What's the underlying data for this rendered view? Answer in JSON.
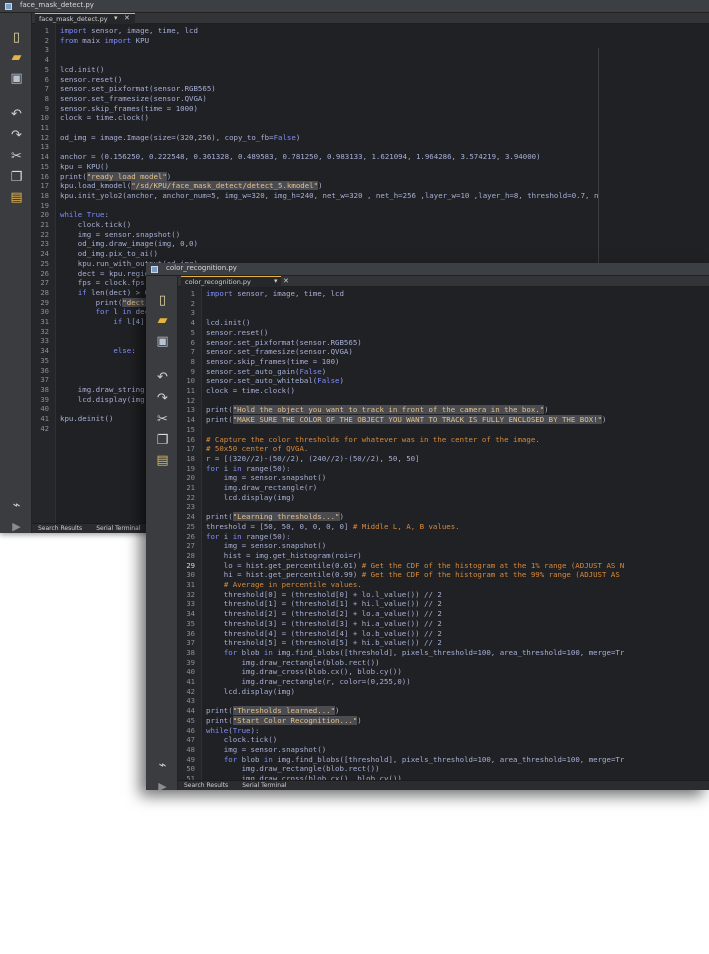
{
  "win1": {
    "title": "face_mask_detect.py",
    "tab": "face_mask_detect.py",
    "tab_menu": "▾",
    "tab_close": "✕",
    "status": [
      "Search Results",
      "Serial Terminal"
    ],
    "lines": [
      {
        "n": "1",
        "t": "import sensor, image, time, lcd"
      },
      {
        "n": "2",
        "t": "from maix import KPU"
      },
      {
        "n": "3",
        "t": ""
      },
      {
        "n": "4",
        "t": ""
      },
      {
        "n": "5",
        "t": "lcd.init()"
      },
      {
        "n": "6",
        "t": "sensor.reset()"
      },
      {
        "n": "7",
        "t": "sensor.set_pixformat(sensor.RGB565)"
      },
      {
        "n": "8",
        "t": "sensor.set_framesize(sensor.QVGA)"
      },
      {
        "n": "9",
        "t": "sensor.skip_frames(time = 1000)"
      },
      {
        "n": "10",
        "t": "clock = time.clock()"
      },
      {
        "n": "11",
        "t": ""
      },
      {
        "n": "12",
        "t": "od_img = image.Image(size=(320,256), copy_to_fb=False)"
      },
      {
        "n": "13",
        "t": ""
      },
      {
        "n": "14",
        "t": "anchor = (0.156250, 0.222548, 0.361328, 0.489583, 0.781250, 0.983133, 1.621094, 1.964286, 3.574219, 3.94000)"
      },
      {
        "n": "15",
        "t": "kpu = KPU()"
      },
      {
        "n": "16",
        "t": "print(\"ready load model\")"
      },
      {
        "n": "17",
        "t": "kpu.load_kmodel(\"/sd/KPU/face_mask_detect/detect_5.kmodel\")"
      },
      {
        "n": "18",
        "t": "kpu.init_yolo2(anchor, anchor_num=5, img_w=320, img_h=240, net_w=320 , net_h=256 ,layer_w=10 ,layer_h=8, threshold=0.7, n"
      },
      {
        "n": "19",
        "t": ""
      },
      {
        "n": "20",
        "t": "while True:"
      },
      {
        "n": "21",
        "t": "    clock.tick()"
      },
      {
        "n": "22",
        "t": "    img = sensor.snapshot()"
      },
      {
        "n": "23",
        "t": "    od_img.draw_image(img, 0,0)"
      },
      {
        "n": "24",
        "t": "    od_img.pix_to_ai()"
      },
      {
        "n": "25",
        "t": "    kpu.run_with_output(od_img)"
      },
      {
        "n": "26",
        "t": "    dect = kpu.regionlayer_yolo2()"
      },
      {
        "n": "27",
        "t": "    fps = clock.fps()"
      },
      {
        "n": "28",
        "t": "    if len(dect) > 0:"
      },
      {
        "n": "29",
        "t": "        print(\"dect:\",dect)"
      },
      {
        "n": "30",
        "t": "        for l in dect :"
      },
      {
        "n": "31",
        "t": "            if l[4] :"
      },
      {
        "n": "32",
        "t": ""
      },
      {
        "n": "33",
        "t": ""
      },
      {
        "n": "34",
        "t": "            else:"
      },
      {
        "n": "35",
        "t": ""
      },
      {
        "n": "36",
        "t": ""
      },
      {
        "n": "37",
        "t": ""
      },
      {
        "n": "38",
        "t": "    img.draw_string(0, 0, \"%2.1ffps\" %(fps), color=(0, 60, 255), scale=2.0)"
      },
      {
        "n": "39",
        "t": "    lcd.display(img)"
      },
      {
        "n": "40",
        "t": ""
      },
      {
        "n": "41",
        "t": "kpu.deinit()"
      },
      {
        "n": "42",
        "t": ""
      }
    ]
  },
  "win2": {
    "title": "color_recognition.py",
    "tab": "color_recognition.py",
    "tab_menu": "▾",
    "tab_close": "✕",
    "status": [
      "Search Results",
      "Serial Terminal"
    ],
    "lines": [
      {
        "n": "1",
        "t": "import sensor, image, time, lcd"
      },
      {
        "n": "2",
        "t": ""
      },
      {
        "n": "3",
        "t": ""
      },
      {
        "n": "4",
        "t": "lcd.init()"
      },
      {
        "n": "5",
        "t": "sensor.reset()"
      },
      {
        "n": "6",
        "t": "sensor.set_pixformat(sensor.RGB565)"
      },
      {
        "n": "7",
        "t": "sensor.set_framesize(sensor.QVGA)"
      },
      {
        "n": "8",
        "t": "sensor.skip_frames(time = 100)"
      },
      {
        "n": "9",
        "t": "sensor.set_auto_gain(False)"
      },
      {
        "n": "10",
        "t": "sensor.set_auto_whitebal(False)"
      },
      {
        "n": "11",
        "t": "clock = time.clock()"
      },
      {
        "n": "12",
        "t": ""
      },
      {
        "n": "13",
        "t": "print(\"Hold the object you want to track in front of the camera in the box.\")"
      },
      {
        "n": "14",
        "t": "print(\"MAKE SURE THE COLOR OF THE OBJECT YOU WANT TO TRACK IS FULLY ENCLOSED BY THE BOX!\")"
      },
      {
        "n": "15",
        "t": ""
      },
      {
        "n": "16",
        "t": "# Capture the color thresholds for whatever was in the center of the image."
      },
      {
        "n": "17",
        "t": "# 50x50 center of QVGA."
      },
      {
        "n": "18",
        "t": "r = [(320//2)-(50//2), (240//2)-(50//2), 50, 50]"
      },
      {
        "n": "19",
        "t": "for i in range(50):"
      },
      {
        "n": "20",
        "t": "    img = sensor.snapshot()"
      },
      {
        "n": "21",
        "t": "    img.draw_rectangle(r)"
      },
      {
        "n": "22",
        "t": "    lcd.display(img)"
      },
      {
        "n": "23",
        "t": ""
      },
      {
        "n": "24",
        "t": "print(\"Learning thresholds...\")"
      },
      {
        "n": "25",
        "t": "threshold = [50, 50, 0, 0, 0, 0] # Middle L, A, B values."
      },
      {
        "n": "26",
        "t": "for i in range(50):"
      },
      {
        "n": "27",
        "t": "    img = sensor.snapshot()"
      },
      {
        "n": "28",
        "t": "    hist = img.get_histogram(roi=r)"
      },
      {
        "n": "29",
        "t": "    lo = hist.get_percentile(0.01) # Get the CDF of the histogram at the 1% range (ADJUST AS N"
      },
      {
        "n": "30",
        "t": "    hi = hist.get_percentile(0.99) # Get the CDF of the histogram at the 99% range (ADJUST AS"
      },
      {
        "n": "31",
        "t": "    # Average in percentile values."
      },
      {
        "n": "32",
        "t": "    threshold[0] = (threshold[0] + lo.l_value()) // 2"
      },
      {
        "n": "33",
        "t": "    threshold[1] = (threshold[1] + hi.l_value()) // 2"
      },
      {
        "n": "34",
        "t": "    threshold[2] = (threshold[2] + lo.a_value()) // 2"
      },
      {
        "n": "35",
        "t": "    threshold[3] = (threshold[3] + hi.a_value()) // 2"
      },
      {
        "n": "36",
        "t": "    threshold[4] = (threshold[4] + lo.b_value()) // 2"
      },
      {
        "n": "37",
        "t": "    threshold[5] = (threshold[5] + hi.b_value()) // 2"
      },
      {
        "n": "38",
        "t": "    for blob in img.find_blobs([threshold], pixels_threshold=100, area_threshold=100, merge=Tr"
      },
      {
        "n": "39",
        "t": "        img.draw_rectangle(blob.rect())"
      },
      {
        "n": "40",
        "t": "        img.draw_cross(blob.cx(), blob.cy())"
      },
      {
        "n": "41",
        "t": "        img.draw_rectangle(r, color=(0,255,0))"
      },
      {
        "n": "42",
        "t": "    lcd.display(img)"
      },
      {
        "n": "43",
        "t": ""
      },
      {
        "n": "44",
        "t": "print(\"Thresholds learned...\")"
      },
      {
        "n": "45",
        "t": "print(\"Start Color Recognition...\")"
      },
      {
        "n": "46",
        "t": "while(True):"
      },
      {
        "n": "47",
        "t": "    clock.tick()"
      },
      {
        "n": "48",
        "t": "    img = sensor.snapshot()"
      },
      {
        "n": "49",
        "t": "    for blob in img.find_blobs([threshold], pixels_threshold=100, area_threshold=100, merge=Tr"
      },
      {
        "n": "50",
        "t": "        img.draw_rectangle(blob.rect())"
      },
      {
        "n": "51",
        "t": "        img.draw_cross(blob.cx(), blob.cy())"
      }
    ]
  },
  "toolbar_icons": [
    "new-file-icon",
    "open-folder-icon",
    "save-icon",
    "undo-icon",
    "redo-icon",
    "cut-icon",
    "copy-icon",
    "paste-icon",
    "connect-icon",
    "run-icon"
  ],
  "colors": {
    "editor_bg": "#202124",
    "keyword": "#7f8cff",
    "string": "#e6c18a",
    "comment": "#d88a3a",
    "text": "#a7b0d6"
  }
}
